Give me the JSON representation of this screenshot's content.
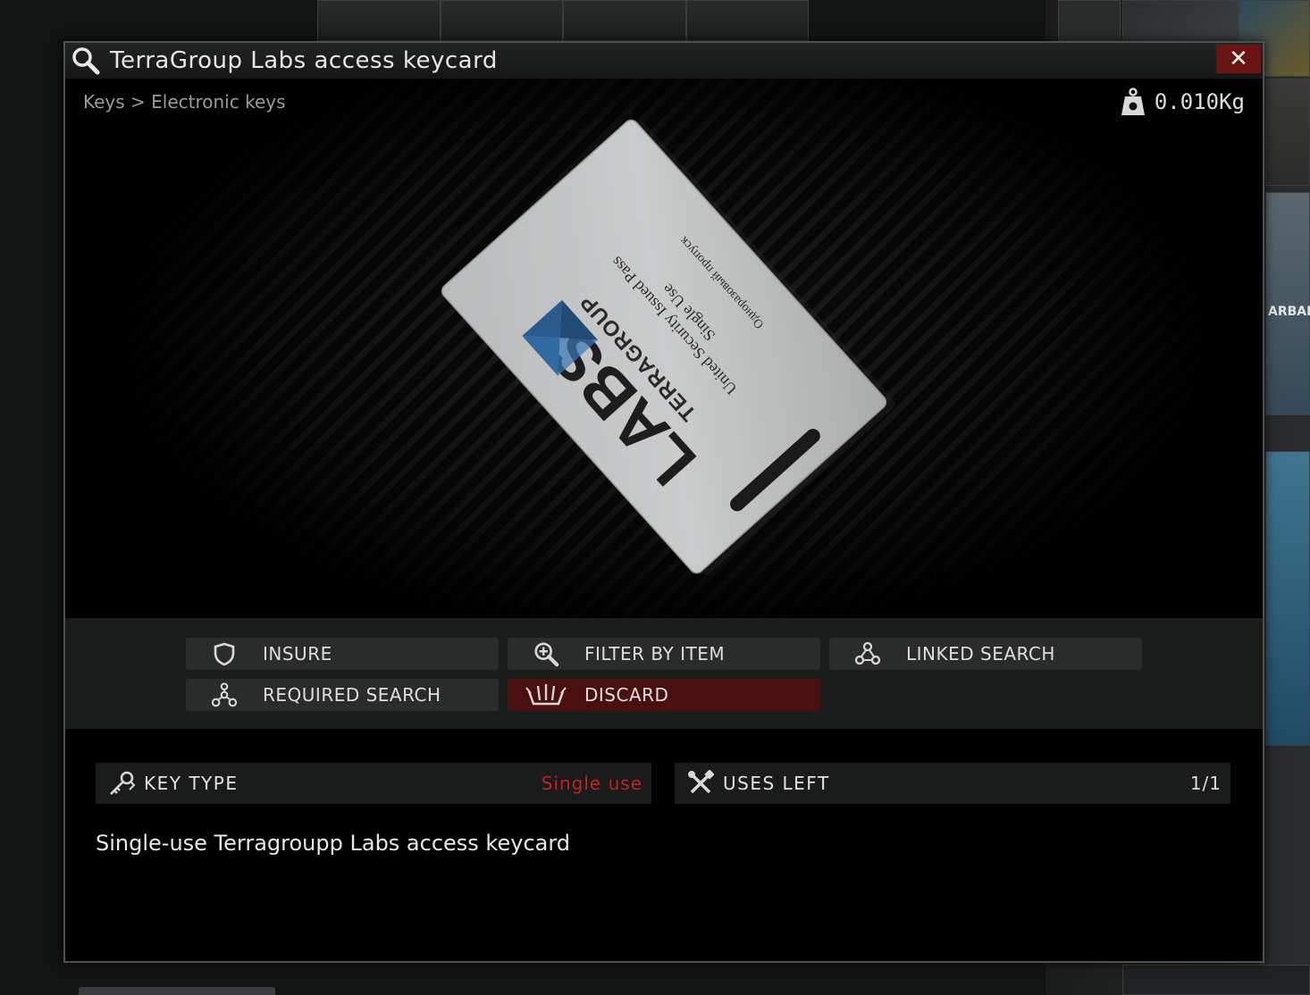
{
  "window": {
    "title": "TerraGroup Labs access keycard",
    "close_symbol": "✕"
  },
  "breadcrumb": "Keys > Electronic keys",
  "weight": "0.010Kg",
  "card": {
    "logo": "LABS",
    "brand": "TERRAGROUP",
    "line1": "United Security Issued Pass",
    "line2": "Single Use",
    "line3": "Одноразовый пропуск"
  },
  "actions": [
    {
      "label": "INSURE",
      "icon": "shield-icon"
    },
    {
      "label": "FILTER BY ITEM",
      "icon": "magnifier-plus-icon"
    },
    {
      "label": "LINKED SEARCH",
      "icon": "nodes-icon"
    },
    {
      "label": "REQUIRED SEARCH",
      "icon": "nodes-icon"
    },
    {
      "label": "DISCARD",
      "icon": "discard-icon"
    }
  ],
  "stats": {
    "key_type": {
      "label": "KEY TYPE",
      "value": "Single use",
      "value_color": "#c0241f",
      "icon": "keys-icon"
    },
    "uses_left": {
      "label": "USES LEFT",
      "value": "1/1",
      "value_color": "#dcdcdc",
      "icon": "tools-icon"
    }
  },
  "description": "Single-use Terragroupp Labs access keycard",
  "background": {
    "partial_label": "ARBAN"
  }
}
